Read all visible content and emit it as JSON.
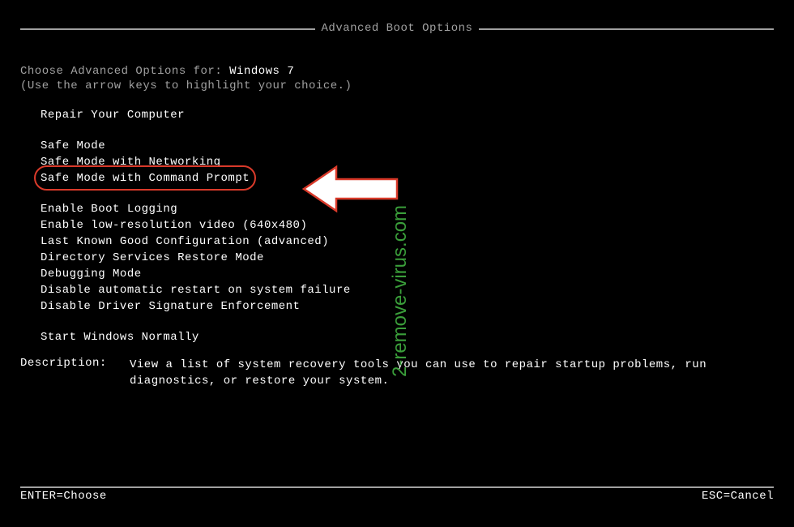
{
  "title": "Advanced Boot Options",
  "prompt": {
    "prefix": "Choose Advanced Options for: ",
    "os": "Windows 7",
    "hint": "(Use the arrow keys to highlight your choice.)"
  },
  "menu": {
    "group1": [
      "Repair Your Computer"
    ],
    "group2": [
      "Safe Mode",
      "Safe Mode with Networking",
      "Safe Mode with Command Prompt"
    ],
    "group3": [
      "Enable Boot Logging",
      "Enable low-resolution video (640x480)",
      "Last Known Good Configuration (advanced)",
      "Directory Services Restore Mode",
      "Debugging Mode",
      "Disable automatic restart on system failure",
      "Disable Driver Signature Enforcement"
    ],
    "group4": [
      "Start Windows Normally"
    ],
    "highlighted_index_in_group2": 2
  },
  "description": {
    "label": "Description:",
    "text": "View a list of system recovery tools you can use to repair startup problems, run diagnostics, or restore your system."
  },
  "footer": {
    "left": "ENTER=Choose",
    "right": "ESC=Cancel"
  },
  "watermark_text": "2-remove-virus.com",
  "annotation": {
    "highlight_color": "#d93a2a",
    "arrow_color": "#ffffff"
  }
}
